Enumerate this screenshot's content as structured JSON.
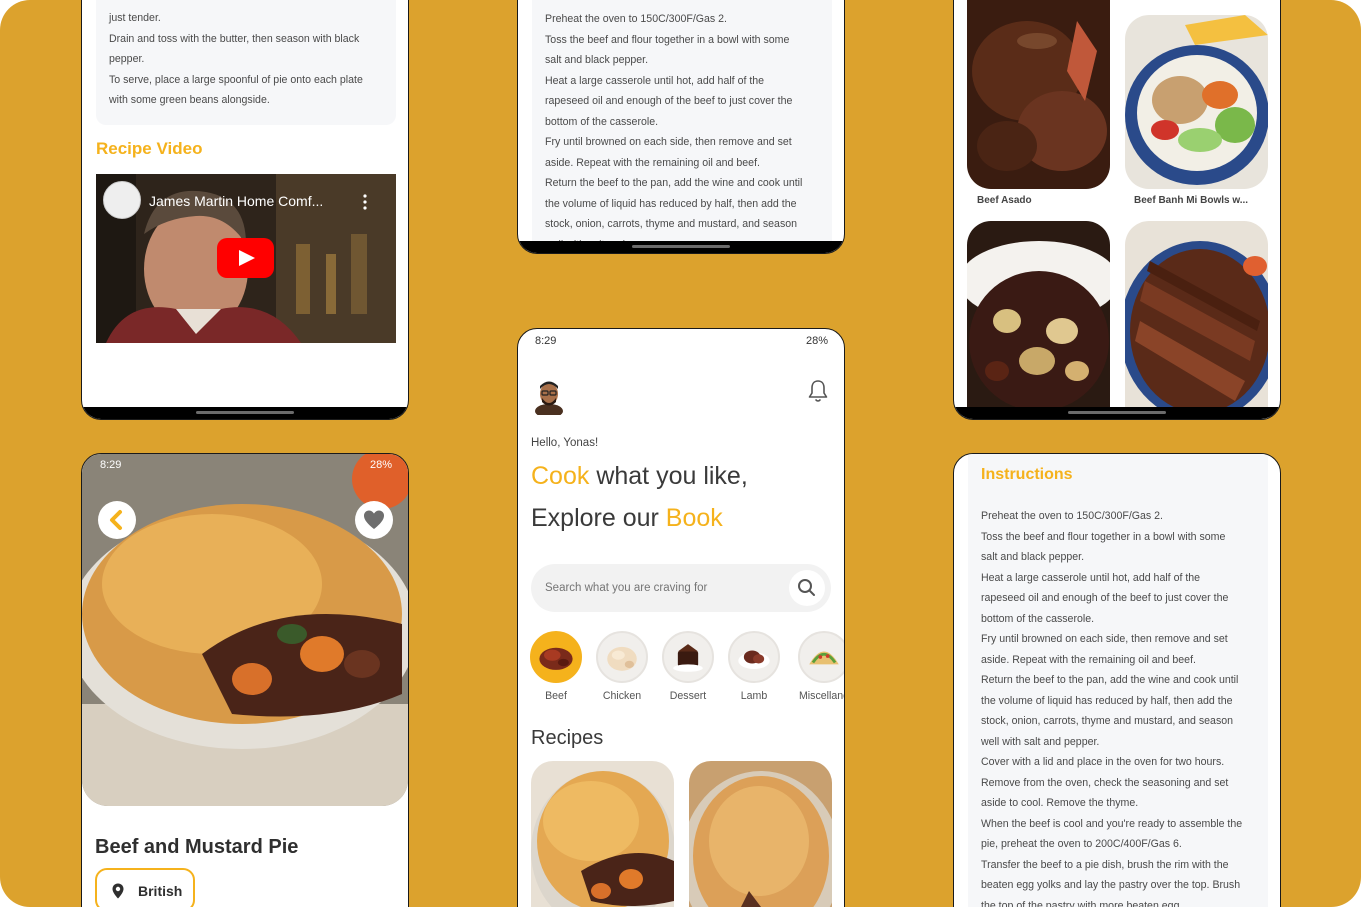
{
  "colors": {
    "background": "#DCA22D",
    "accent": "#F5B21C",
    "text": "#2f2f2f",
    "muted": "#555555"
  },
  "recipe_detail_top": {
    "instructions_tail": [
      "just tender.",
      "Drain and toss with the butter, then season with black",
      "pepper.",
      "To serve, place a large spoonful of pie onto each plate",
      "with some green beans alongside."
    ],
    "video_heading": "Recipe Video",
    "video_title": "James Martin Home Comf...",
    "channel_icon": "channel-avatar-icon",
    "play_icon": "youtube-play-icon",
    "more_icon": "more-vertical-icon"
  },
  "instructions_top": {
    "lines": [
      "Preheat the oven to 150C/300F/Gas 2.",
      "Toss the beef and flour together in a bowl with some",
      "salt and black pepper.",
      "Heat a large casserole until hot, add half of the",
      "rapeseed oil and enough of the beef to just cover the",
      "bottom of the casserole.",
      "Fry until browned on each side, then remove and set",
      "aside. Repeat with the remaining oil and beef.",
      "Return the beef to the pan, add the wine and cook until",
      "the volume of liquid has reduced by half, then add the",
      "stock, onion, carrots, thyme and mustard, and season",
      "well with salt and pepper."
    ]
  },
  "meals_grid": {
    "items": [
      {
        "label": "Beef Asado"
      },
      {
        "label": "Beef Banh Mi Bowls w..."
      }
    ]
  },
  "recipe_detail": {
    "status": {
      "time": "8:29",
      "battery": "28%"
    },
    "back_icon": "chevron-left-icon",
    "favorite_icon": "heart-icon",
    "title": "Beef and Mustard Pie",
    "area": "British",
    "area_icon": "location-pin-icon"
  },
  "home": {
    "status": {
      "time": "8:29",
      "battery": "28%"
    },
    "greeting": "Hello, Yonas!",
    "headline": {
      "line1_accent": "Cook",
      "line1_rest": " what you like,",
      "line2_rest": "Explore our ",
      "line2_accent": "Book"
    },
    "search": {
      "placeholder": "Search what you are craving for",
      "icon": "search-icon"
    },
    "notification_icon": "bell-icon",
    "avatar_icon": "avatar-icon",
    "categories": [
      {
        "label": "Beef",
        "active": true
      },
      {
        "label": "Chicken"
      },
      {
        "label": "Dessert"
      },
      {
        "label": "Lamb"
      },
      {
        "label": "Miscellane"
      }
    ],
    "recipes_heading": "Recipes"
  },
  "instructions_full": {
    "heading": "Instructions",
    "lines": [
      "Preheat the oven to 150C/300F/Gas 2.",
      "Toss the beef and flour together in a bowl with some",
      "salt and black pepper.",
      "Heat a large casserole until hot, add half of the",
      "rapeseed oil and enough of the beef to just cover the",
      "bottom of the casserole.",
      "Fry until browned on each side, then remove and set",
      "aside. Repeat with the remaining oil and beef.",
      "Return the beef to the pan, add the wine and cook until",
      "the volume of liquid has reduced by half, then add the",
      "stock, onion, carrots, thyme and mustard, and season",
      "well with salt and pepper.",
      "Cover with a lid and place in the oven for two hours.",
      "Remove from the oven, check the seasoning and set",
      "aside to cool. Remove the thyme.",
      "When the beef is cool and you're ready to assemble the",
      "pie, preheat the oven to 200C/400F/Gas 6.",
      "Transfer the beef to a pie dish, brush the rim with the",
      "beaten egg yolks and lay the pastry over the top. Brush",
      "the top of the pastry with more beaten egg."
    ]
  }
}
